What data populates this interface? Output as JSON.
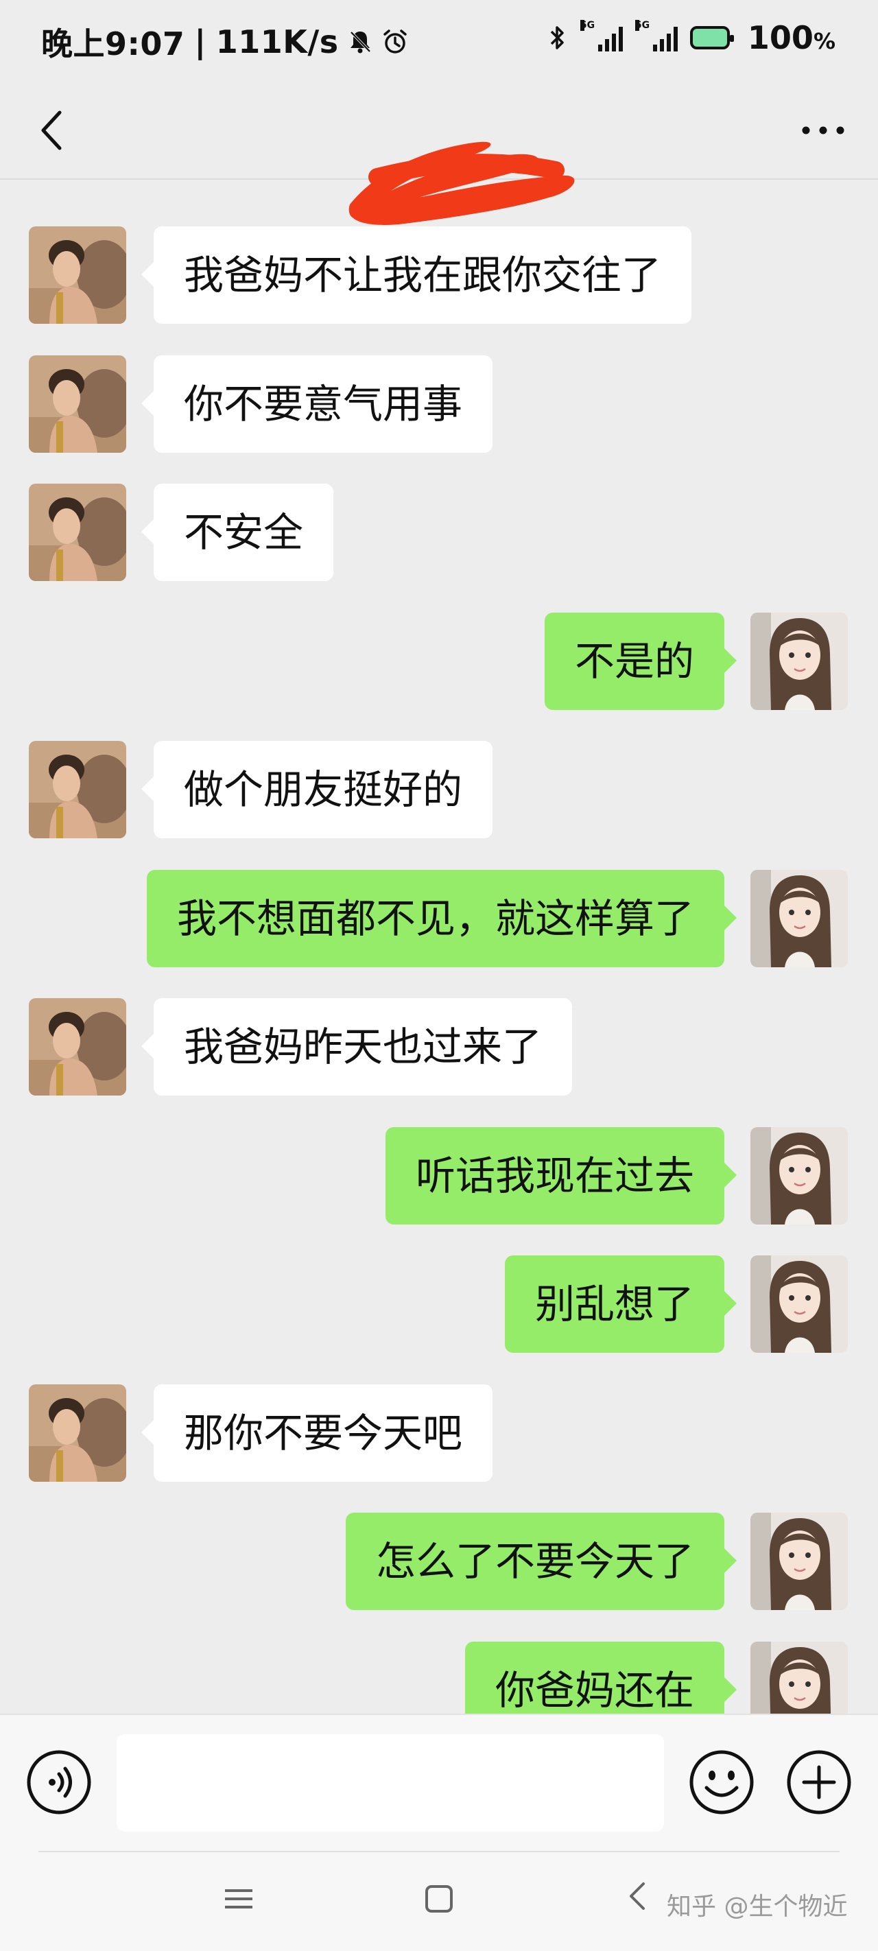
{
  "status_bar": {
    "time": "晚上9:07",
    "separator": "|",
    "net_speed": "111K/s",
    "net_label_5g_1": "5G",
    "net_label_5g_2": "5G",
    "battery": "100",
    "battery_unit": "%"
  },
  "header": {
    "title_redacted": true
  },
  "messages": [
    {
      "side": "in",
      "text": "我爸妈不让我在跟你交往了"
    },
    {
      "side": "in",
      "text": "你不要意气用事"
    },
    {
      "side": "in",
      "text": "不安全"
    },
    {
      "side": "out",
      "text": "不是的"
    },
    {
      "side": "in",
      "text": "做个朋友挺好的"
    },
    {
      "side": "out",
      "text": "我不想面都不见，就这样算了"
    },
    {
      "side": "in",
      "text": "我爸妈昨天也过来了"
    },
    {
      "side": "out",
      "text": "听话我现在过去"
    },
    {
      "side": "out",
      "text": "别乱想了"
    },
    {
      "side": "in",
      "text": "那你不要今天吧"
    },
    {
      "side": "out",
      "text": "怎么了不要今天了"
    },
    {
      "side": "out",
      "text": "你爸妈还在"
    }
  ],
  "input_bar": {
    "value": "",
    "placeholder": ""
  },
  "watermark": "知乎 @生个物近",
  "colors": {
    "background": "#ededed",
    "incoming_bubble": "#ffffff",
    "outgoing_bubble": "#95ec69",
    "redaction": "#f13a17"
  },
  "icons": {
    "back": "back-arrow-icon",
    "more": "more-dots-icon",
    "voice": "voice-icon",
    "emoji": "emoji-icon",
    "plus": "plus-icon",
    "nav_menu": "menu-icon",
    "nav_home": "home-icon",
    "nav_back": "nav-back-icon"
  }
}
